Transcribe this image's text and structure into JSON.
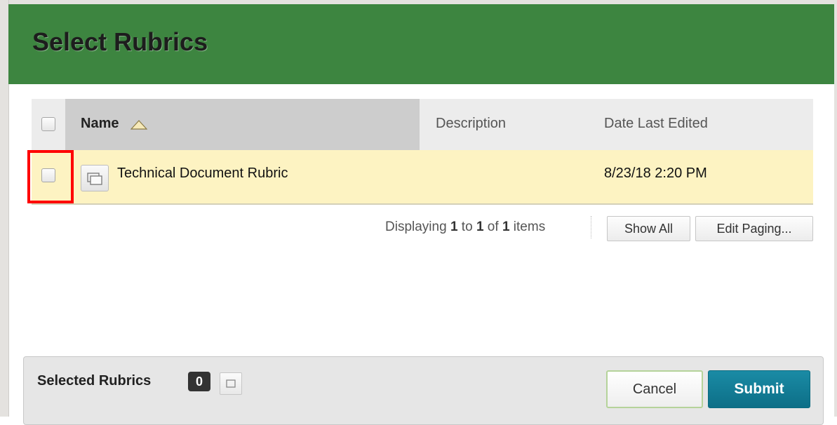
{
  "dialog": {
    "title": "Select Rubrics"
  },
  "table": {
    "headers": {
      "name": "Name",
      "description": "Description",
      "date": "Date Last Edited"
    },
    "rows": [
      {
        "name": "Technical Document Rubric",
        "description": "",
        "date": "8/23/18 2:20 PM"
      }
    ]
  },
  "paging": {
    "prefix": "Displaying",
    "from": "1",
    "to_word": "to",
    "to": "1",
    "of_word": "of",
    "total": "1",
    "suffix": "items",
    "show_all": "Show All",
    "edit_paging": "Edit Paging..."
  },
  "footer": {
    "selected_label": "Selected Rubrics",
    "selected_count": "0",
    "cancel": "Cancel",
    "submit": "Submit"
  },
  "colors": {
    "header_green": "#3d8540",
    "row_highlight": "#fdf3c2",
    "submit_blue": "#0d6f87",
    "annotation_red": "#ff0000"
  },
  "icons": {
    "sort": "sort-ascending-icon",
    "open": "open-window-icon",
    "toggle": "expand-selection-icon"
  }
}
